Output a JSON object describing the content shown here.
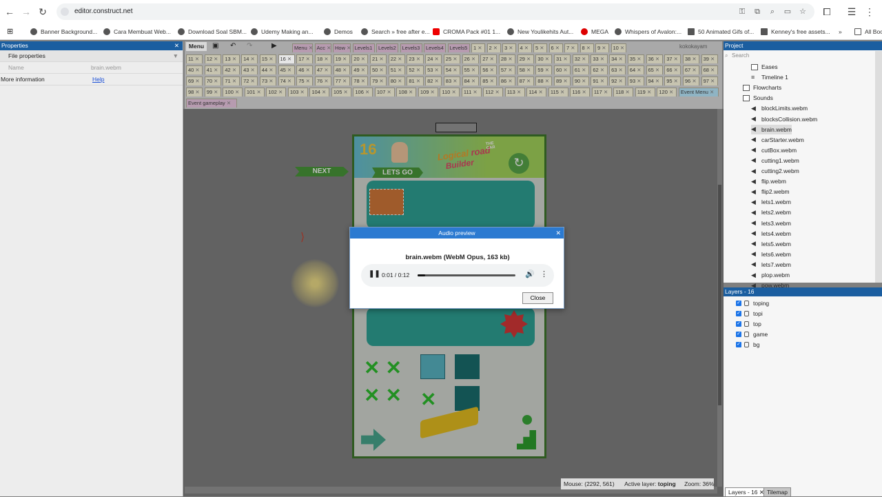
{
  "browser": {
    "url": "editor.construct.net",
    "bookmarks": [
      "Banner Background...",
      "Cara Membuat Web...",
      "Download Soal SBM...",
      "Udemy Making an...",
      "Demos",
      "Search » free after e...",
      "CROMA Pack #01 1...",
      "New Youlikehits Aut...",
      "MEGA",
      "Whispers of Avalon:...",
      "50 Animated Gifs of...",
      "Kenney's free assets...",
      "All Bookmarks"
    ],
    "more": "»"
  },
  "properties": {
    "title": "Properties",
    "section": "File properties",
    "name_label": "Name",
    "name_value": "brain.webm",
    "more_label": "More information",
    "help": "Help"
  },
  "toolbar": {
    "menu": "Menu",
    "user": "kokokayam"
  },
  "tabs": {
    "row1": [
      "Menu",
      "Acc",
      "How",
      "Levels1",
      "Levels2",
      "Levels3",
      "Levels4",
      "Levels5",
      "1",
      "2",
      "3",
      "4",
      "5",
      "6",
      "7",
      "8",
      "9",
      "10"
    ],
    "row2": [
      "11",
      "12",
      "13",
      "14",
      "15",
      "16",
      "17",
      "18",
      "19",
      "20",
      "21",
      "22",
      "23",
      "24",
      "25",
      "26",
      "27",
      "28",
      "29",
      "30",
      "31",
      "32",
      "33",
      "34",
      "35",
      "36",
      "37",
      "38",
      "39"
    ],
    "row3": [
      "40",
      "41",
      "42",
      "43",
      "44",
      "45",
      "46",
      "47",
      "48",
      "49",
      "50",
      "51",
      "52",
      "53",
      "54",
      "55",
      "56",
      "57",
      "58",
      "59",
      "60",
      "61",
      "62",
      "63",
      "64",
      "65",
      "66",
      "67",
      "68"
    ],
    "row4": [
      "69",
      "70",
      "71",
      "72",
      "73",
      "74",
      "75",
      "76",
      "77",
      "78",
      "79",
      "80",
      "81",
      "82",
      "83",
      "84",
      "85",
      "86",
      "87",
      "88",
      "89",
      "90",
      "91",
      "92",
      "93",
      "94",
      "95",
      "96",
      "97"
    ],
    "row5": [
      "98",
      "99",
      "100",
      "101",
      "102",
      "103",
      "104",
      "105",
      "106",
      "107",
      "108",
      "109",
      "110",
      "111",
      "112",
      "113",
      "114",
      "115",
      "116",
      "117",
      "118",
      "119",
      "120",
      "Event Menu"
    ],
    "row6": [
      "Event gameplay"
    ]
  },
  "game": {
    "level": "16",
    "lets_go": "LETS GO",
    "next": "NEXT",
    "logo1": "Logical",
    "logo2": "road",
    "logo3": "Builder",
    "logo4": "THE CAR"
  },
  "dialog": {
    "title": "Audio preview",
    "file_info": "brain.webm (WebM Opus, 163 kb)",
    "time": "0:01 / 0:12",
    "progress": 0.08,
    "close": "Close"
  },
  "status": {
    "mouse": "Mouse: (2292, 561)",
    "layer_label": "Active layer:",
    "layer": "toping",
    "zoom": "Zoom: 36%"
  },
  "project": {
    "title": "Project",
    "search_placeholder": "Search",
    "items": [
      {
        "label": "Eases",
        "icon": "folder"
      },
      {
        "label": "Timeline 1",
        "icon": "timeline"
      },
      {
        "label": "Flowcharts",
        "icon": "folder"
      },
      {
        "label": "Sounds",
        "icon": "folder"
      },
      {
        "label": "blockLimits.webm",
        "icon": "speaker"
      },
      {
        "label": "blocksCollision.webm",
        "icon": "speaker"
      },
      {
        "label": "brain.webm",
        "icon": "speaker"
      },
      {
        "label": "carStarter.webm",
        "icon": "speaker"
      },
      {
        "label": "cutBox.webm",
        "icon": "speaker"
      },
      {
        "label": "cutting1.webm",
        "icon": "speaker"
      },
      {
        "label": "cutting2.webm",
        "icon": "speaker"
      },
      {
        "label": "flip.webm",
        "icon": "speaker"
      },
      {
        "label": "flip2.webm",
        "icon": "speaker"
      },
      {
        "label": "lets1.webm",
        "icon": "speaker"
      },
      {
        "label": "lets2.webm",
        "icon": "speaker"
      },
      {
        "label": "lets3.webm",
        "icon": "speaker"
      },
      {
        "label": "lets4.webm",
        "icon": "speaker"
      },
      {
        "label": "lets5.webm",
        "icon": "speaker"
      },
      {
        "label": "lets6.webm",
        "icon": "speaker"
      },
      {
        "label": "lets7.webm",
        "icon": "speaker"
      },
      {
        "label": "plop.webm",
        "icon": "speaker"
      },
      {
        "label": "pow.webm",
        "icon": "speaker"
      }
    ]
  },
  "layers": {
    "title": "Layers - 16",
    "items": [
      "toping",
      "topi",
      "top",
      "game",
      "bg"
    ],
    "bottom_tabs": [
      "Layers - 16",
      "Tilemap"
    ]
  },
  "colors": {
    "panel_title": "#1b5ea0",
    "dialog_title": "#2b7ad1",
    "game_border": "#3f7a2c",
    "teal": "#3aa99a"
  }
}
